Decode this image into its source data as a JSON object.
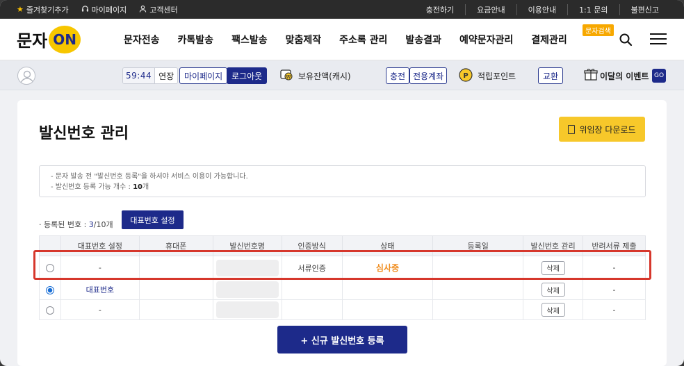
{
  "utilbar": {
    "left": [
      {
        "label": "즐겨찾기추가",
        "icon": "star-icon"
      },
      {
        "label": "마이페이지",
        "icon": "headset-icon"
      },
      {
        "label": "고객센터",
        "icon": "person-icon"
      }
    ],
    "right": [
      "충전하기",
      "요금안내",
      "이용안내",
      "1:1 문의",
      "불편신고"
    ]
  },
  "header": {
    "logo_text": "문자",
    "logo_badge": "ON",
    "nav": [
      "문자전송",
      "카톡발송",
      "팩스발송",
      "맞춤제작",
      "주소록 관리",
      "발송결과",
      "예약문자관리",
      "결제관리"
    ],
    "search_tag": "문자검색"
  },
  "memberbar": {
    "time": "59:44",
    "extend": "연장",
    "mypage": "마이페이지",
    "logout": "로그아웃",
    "balance": "보유잔액(캐시)",
    "charge": "충전",
    "dedicated_account": "전용계좌",
    "points": "적립포인트",
    "exchange": "교환",
    "event": "이달의 이벤트",
    "go": "GO"
  },
  "page": {
    "title": "발신번호 관리",
    "download_btn": "위임장 다운로드",
    "notice_1": "- 문자 발송 전 \"발신번호 등록\"을 하셔야 서비스 이용이 가능합니다.",
    "notice_2_prefix": "- 발신번호 등록 가능 개수 : ",
    "notice_2_value": "10",
    "notice_2_suffix": "개",
    "count_prefix": "· 등록된 번호 : ",
    "count_value": "3",
    "count_suffix": "/10개",
    "rep_btn": "대표번호 설정",
    "new_btn": "+ 신규 발신번호 등록"
  },
  "table": {
    "headers": [
      "",
      "대표번호 설정",
      "휴대폰",
      "발신번호명",
      "인증방식",
      "상태",
      "등록일",
      "발신번호 관리",
      "반려서류 제출"
    ],
    "rows": [
      {
        "rep": "-",
        "auth": "서류인증",
        "status": "심사중",
        "delete": "삭제",
        "reject": "-"
      },
      {
        "rep": "대표번호",
        "auth": "",
        "status": "",
        "delete": "삭제",
        "reject": "-"
      },
      {
        "rep": "-",
        "auth": "",
        "status": "",
        "delete": "삭제",
        "reject": "-"
      }
    ]
  }
}
